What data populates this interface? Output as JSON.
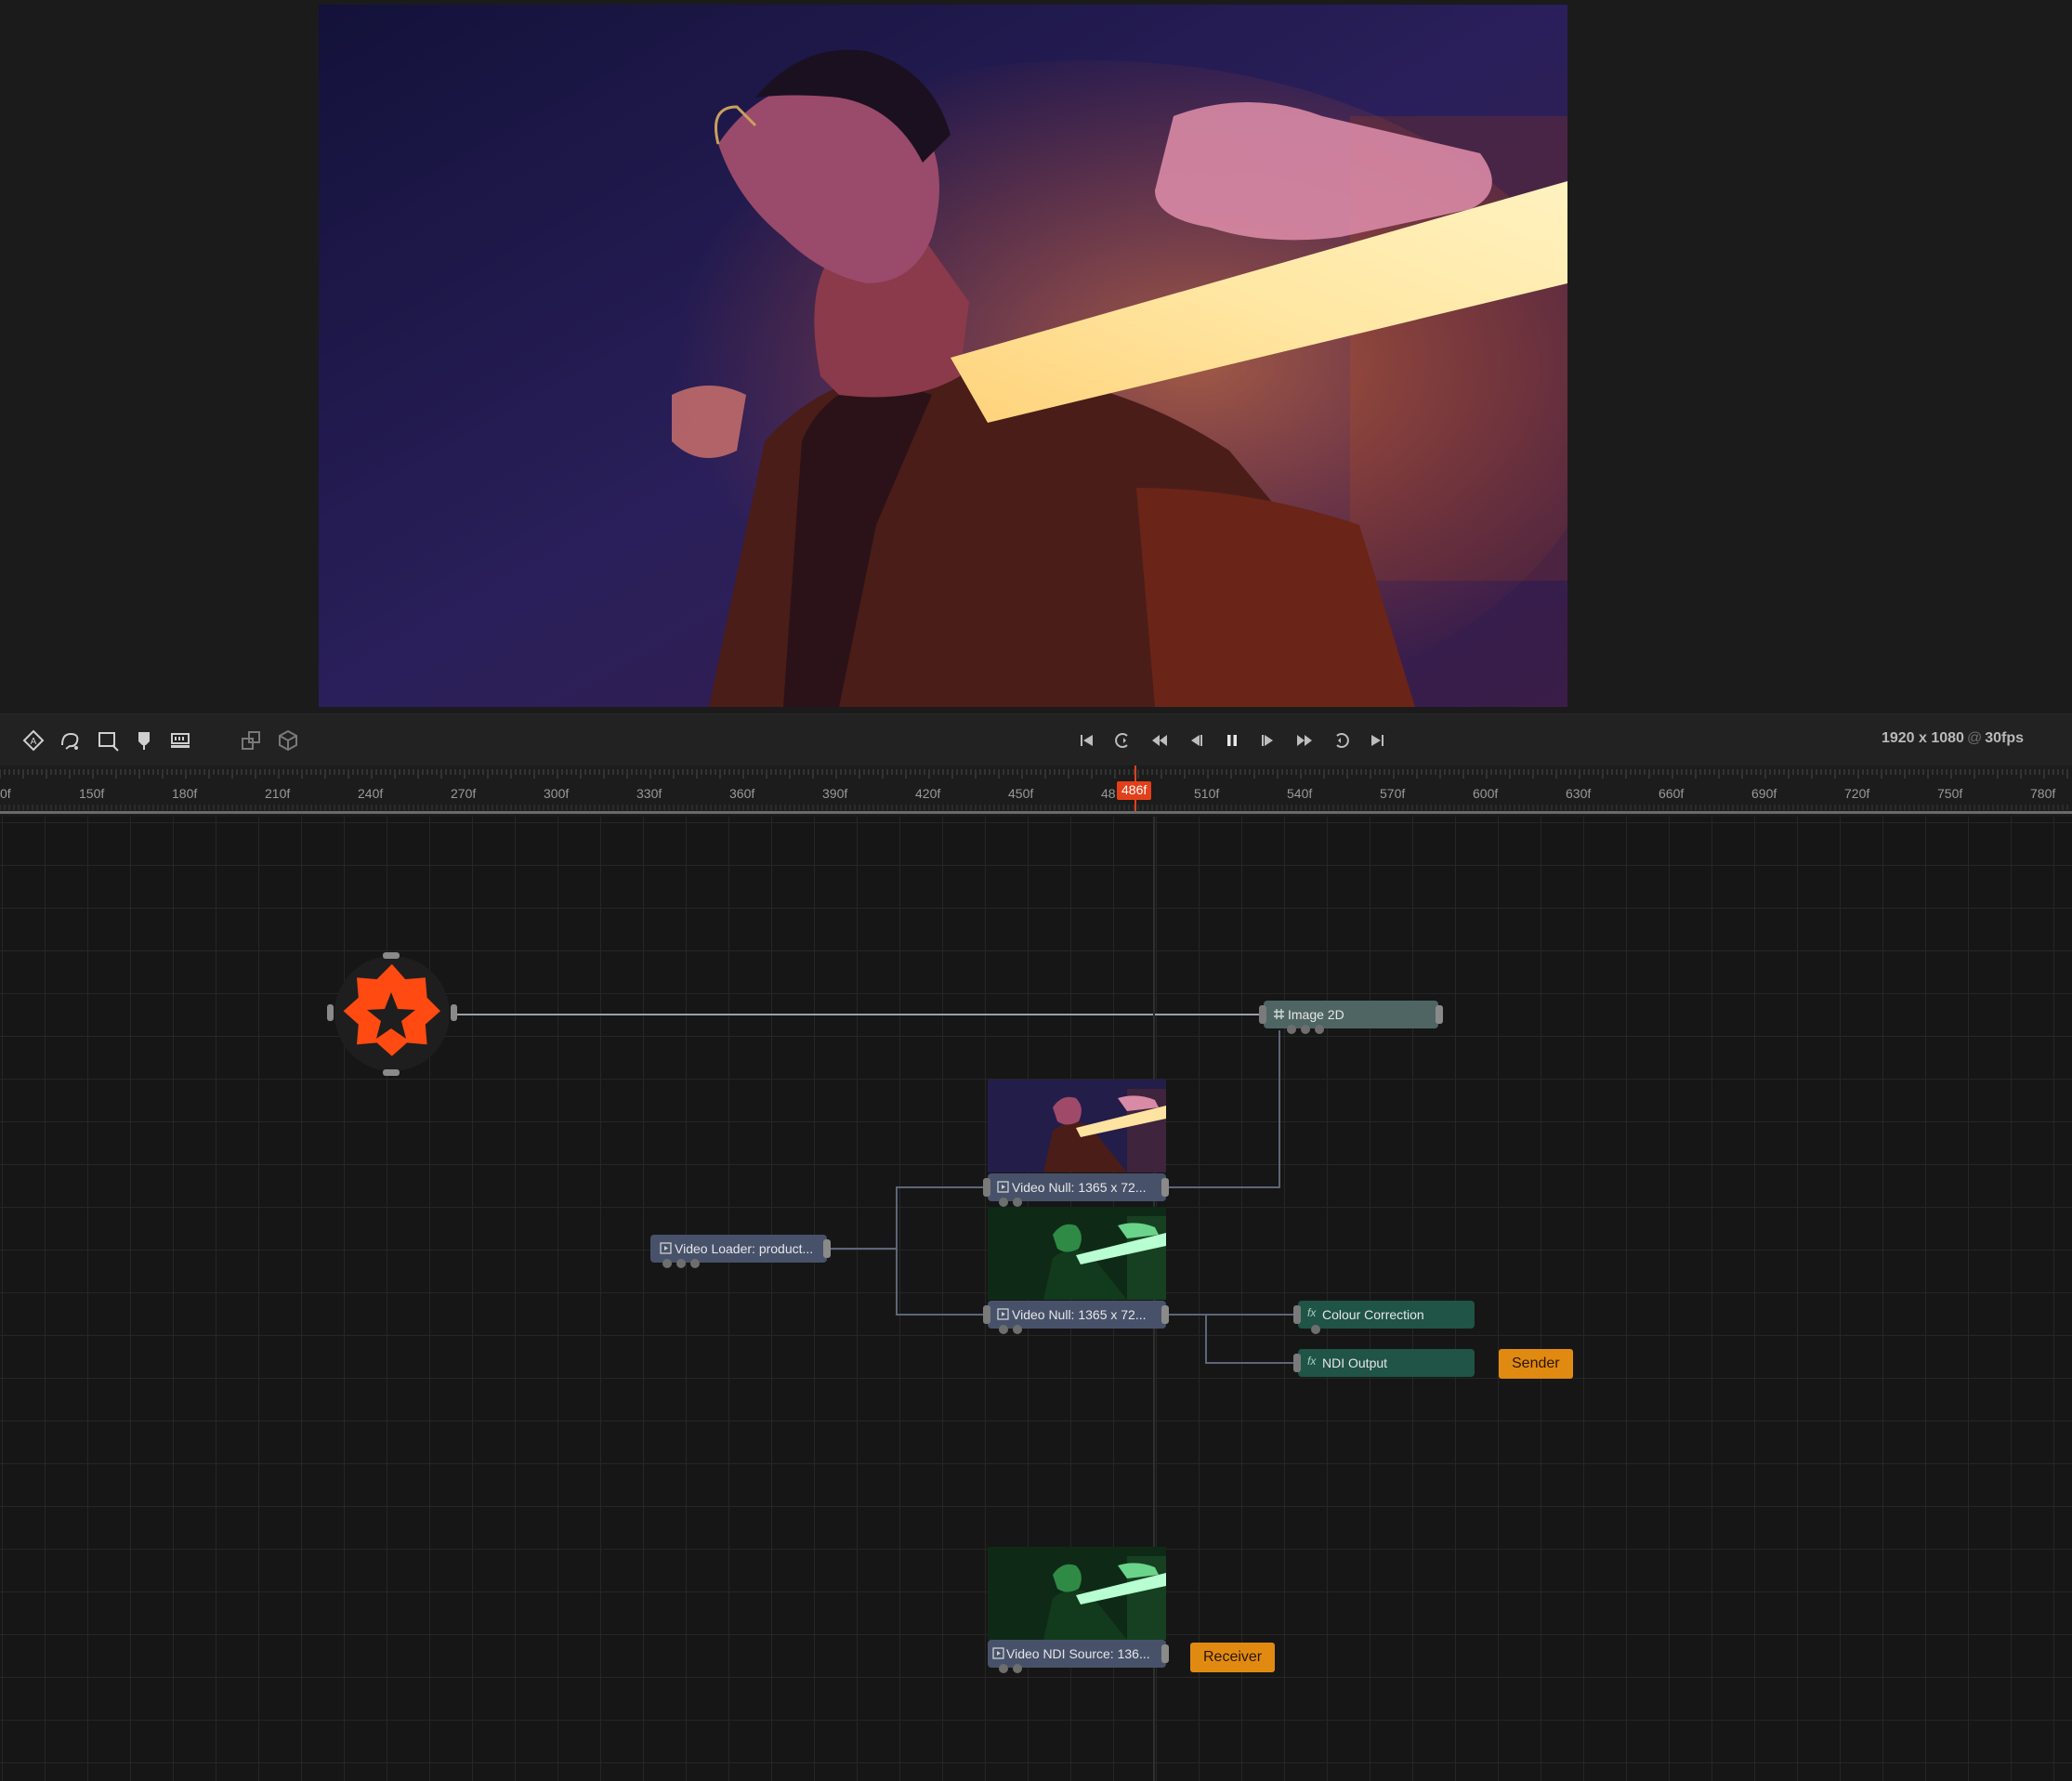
{
  "viewer": {
    "preview_image": "portrait-neon-light-scene"
  },
  "toolbar": {
    "left_tools": [
      "anchor-tool-icon",
      "shape-tool-icon",
      "crop-tool-icon",
      "paint-tool-icon",
      "stamp-tool-icon",
      "transform-tool-icon",
      "3d-box-tool-icon"
    ],
    "transport": [
      "skip-to-start-icon",
      "loop-icon",
      "rewind-icon",
      "step-back-icon",
      "pause-icon",
      "step-forward-icon",
      "fast-forward-icon",
      "loop-forward-icon",
      "skip-to-end-icon"
    ],
    "resolution": "1920 x 1080",
    "at": "@",
    "fps": "30fps"
  },
  "timeline": {
    "labels": [
      "0f",
      "150f",
      "180f",
      "210f",
      "240f",
      "270f",
      "300f",
      "330f",
      "360f",
      "390f",
      "420f",
      "450f",
      "48",
      "510f",
      "540f",
      "570f",
      "600f",
      "630f",
      "660f",
      "690f",
      "720f",
      "750f",
      "780f"
    ],
    "playhead": "486f",
    "accent_color": "#e2401a"
  },
  "graph": {
    "nodes": {
      "image2d": "Image 2D",
      "video_null_1": "Video Null: 1365 x 72...",
      "video_null_2": "Video Null: 1365 x 72...",
      "video_loader": "Video Loader: product...",
      "colour_correction": "Colour Correction",
      "ndi_output": "NDI Output",
      "video_ndi_source": "Video NDI Source: 136..."
    },
    "tags": {
      "sender": "Sender",
      "receiver": "Receiver"
    },
    "logo_color": "#ff4a12"
  }
}
